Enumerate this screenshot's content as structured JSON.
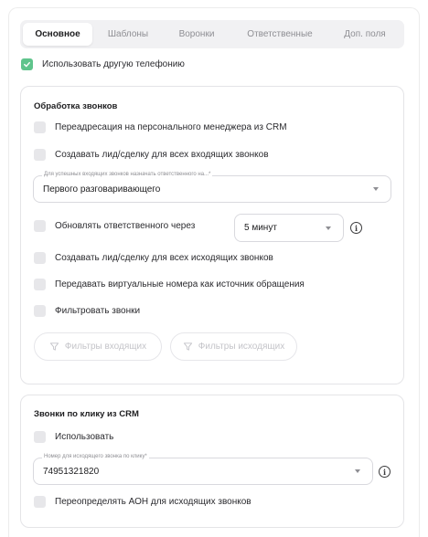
{
  "tabs": [
    {
      "label": "Основное",
      "active": true
    },
    {
      "label": "Шаблоны",
      "active": false
    },
    {
      "label": "Воронки",
      "active": false
    },
    {
      "label": "Ответственные",
      "active": false
    },
    {
      "label": "Доп. поля",
      "active": false
    }
  ],
  "use_other_telephony": {
    "label": "Использовать другую телефонию",
    "checked": true
  },
  "call_processing": {
    "title": "Обработка звонков",
    "redirect_to_manager": {
      "label": "Переадресация на персонального менеджера из CRM",
      "checked": false
    },
    "create_lead_incoming": {
      "label": "Создавать лид/сделку для всех входящих звонков",
      "checked": false
    },
    "assign_select": {
      "label": "Для успешных входящих звонков назначать ответственного на...*",
      "value": "Первого разговаривающего"
    },
    "update_responsible": {
      "label": "Обновлять ответственного через",
      "checked": false,
      "interval": "5 минут",
      "info": "i"
    },
    "create_lead_outgoing": {
      "label": "Создавать лид/сделку для всех исходящих звонков",
      "checked": false
    },
    "pass_virtual_numbers": {
      "label": "Передавать виртуальные номера как источник обращения",
      "checked": false
    },
    "filter_calls": {
      "label": "Фильтровать звонки",
      "checked": false
    },
    "filter_incoming_button": "Фильтры входящих",
    "filter_outgoing_button": "Фильтры исходящих"
  },
  "click_to_call": {
    "title": "Звонки по клику из CRM",
    "use": {
      "label": "Использовать",
      "checked": false
    },
    "number_select": {
      "label": "Номер для исходящего звонка по клику*",
      "value": "74951321820",
      "info": "i"
    },
    "override_caller_id": {
      "label": "Переопределять АОН для исходящих звонков",
      "checked": false
    }
  },
  "colors": {
    "accent_green": "#5fc48c",
    "checkbox_off": "#e7e7ea",
    "border": "#e4e4e7"
  }
}
